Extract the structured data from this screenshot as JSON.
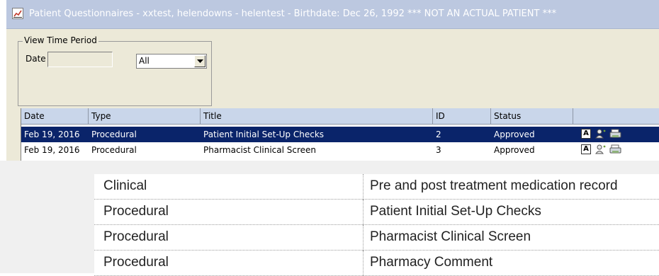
{
  "window": {
    "title": "Patient Questionnaires - xxtest, helendowns  - helentest - Birthdate: Dec 26, 1992 *** NOT AN ACTUAL PATIENT ***",
    "icon": "chart-icon"
  },
  "filter": {
    "group_label": "View Time Period",
    "date_label": "Date",
    "date_value": "",
    "period_selected": "All"
  },
  "grid": {
    "columns": [
      "Date",
      "Type",
      "Title",
      "ID",
      "Status",
      ""
    ],
    "rows": [
      {
        "date": "Feb 19, 2016",
        "type": "Procedural",
        "title": "Patient Initial Set-Up Checks",
        "id": "2",
        "status": "Approved",
        "selected": true
      },
      {
        "date": "Feb 19, 2016",
        "type": "Procedural",
        "title": "Pharmacist Clinical Screen",
        "id": "3",
        "status": "Approved",
        "selected": false
      }
    ],
    "row_icons": [
      "acknowledge-icon",
      "person-icon",
      "print-icon"
    ],
    "icon_letter": "A",
    "colors": {
      "header_bg": "#c9d6ea",
      "selection_bg": "#0a246a"
    }
  },
  "doc_table": {
    "rows": [
      {
        "type": "Clinical",
        "title": "Pre and post treatment medication record"
      },
      {
        "type": "Procedural",
        "title": "Patient Initial Set-Up Checks"
      },
      {
        "type": "Procedural",
        "title": "Pharmacist Clinical Screen"
      },
      {
        "type": "Procedural",
        "title": "Pharmacy Comment"
      }
    ]
  }
}
